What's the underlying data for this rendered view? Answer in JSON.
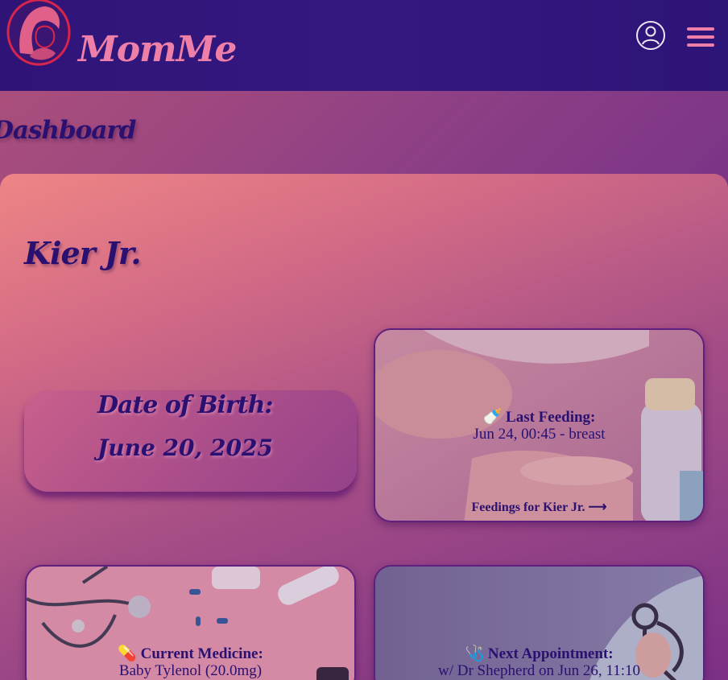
{
  "header": {
    "brand": "MomMe",
    "logo_icon": "mother-baby-logo",
    "profile_icon": "user-circle-icon",
    "menu_icon": "hamburger-menu-icon"
  },
  "page": {
    "title": "Dashboard"
  },
  "baby": {
    "name": "Kier Jr.",
    "dob_label": "Date of Birth:",
    "dob_value": "June 20, 2025"
  },
  "cards": {
    "feeding": {
      "icon": "baby-bottle-icon",
      "emoji": "🍼",
      "title": "Last Feeding:",
      "value": "Jun 24, 00:45 - breast",
      "link": "Feedings for Kier Jr. ⟶"
    },
    "medicine": {
      "icon": "pill-icon",
      "emoji": "💊",
      "title": "Current Medicine:",
      "value": "Baby Tylenol (20.0mg)"
    },
    "appointment": {
      "icon": "stethoscope-icon",
      "emoji": "🩺",
      "title": "Next Appointment:",
      "value": "w/ Dr Shepherd on Jun 26, 11:10"
    }
  },
  "colors": {
    "accent_pink": "#ee7fa8",
    "header_bg": "#2f1478",
    "text_dark": "#2a1070"
  }
}
